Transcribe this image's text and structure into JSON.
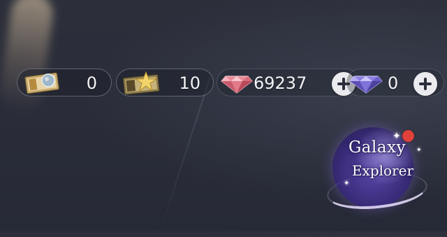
{
  "currencies": [
    {
      "name": "silver-ticket",
      "amount": "0",
      "has_plus": false
    },
    {
      "name": "gold-star-ticket",
      "amount": "10",
      "has_plus": false
    },
    {
      "name": "pink-gem",
      "amount": "69237",
      "has_plus": true
    },
    {
      "name": "purple-gem",
      "amount": "0",
      "has_plus": true
    }
  ],
  "event_badge": {
    "line1": "Galaxy",
    "line2": "Explorer",
    "has_notification": true
  },
  "colors": {
    "notification": "#e0413a",
    "planet": "#4a3a96",
    "pink_gem": "#e88a96",
    "purple_gem": "#8d7fe0"
  }
}
